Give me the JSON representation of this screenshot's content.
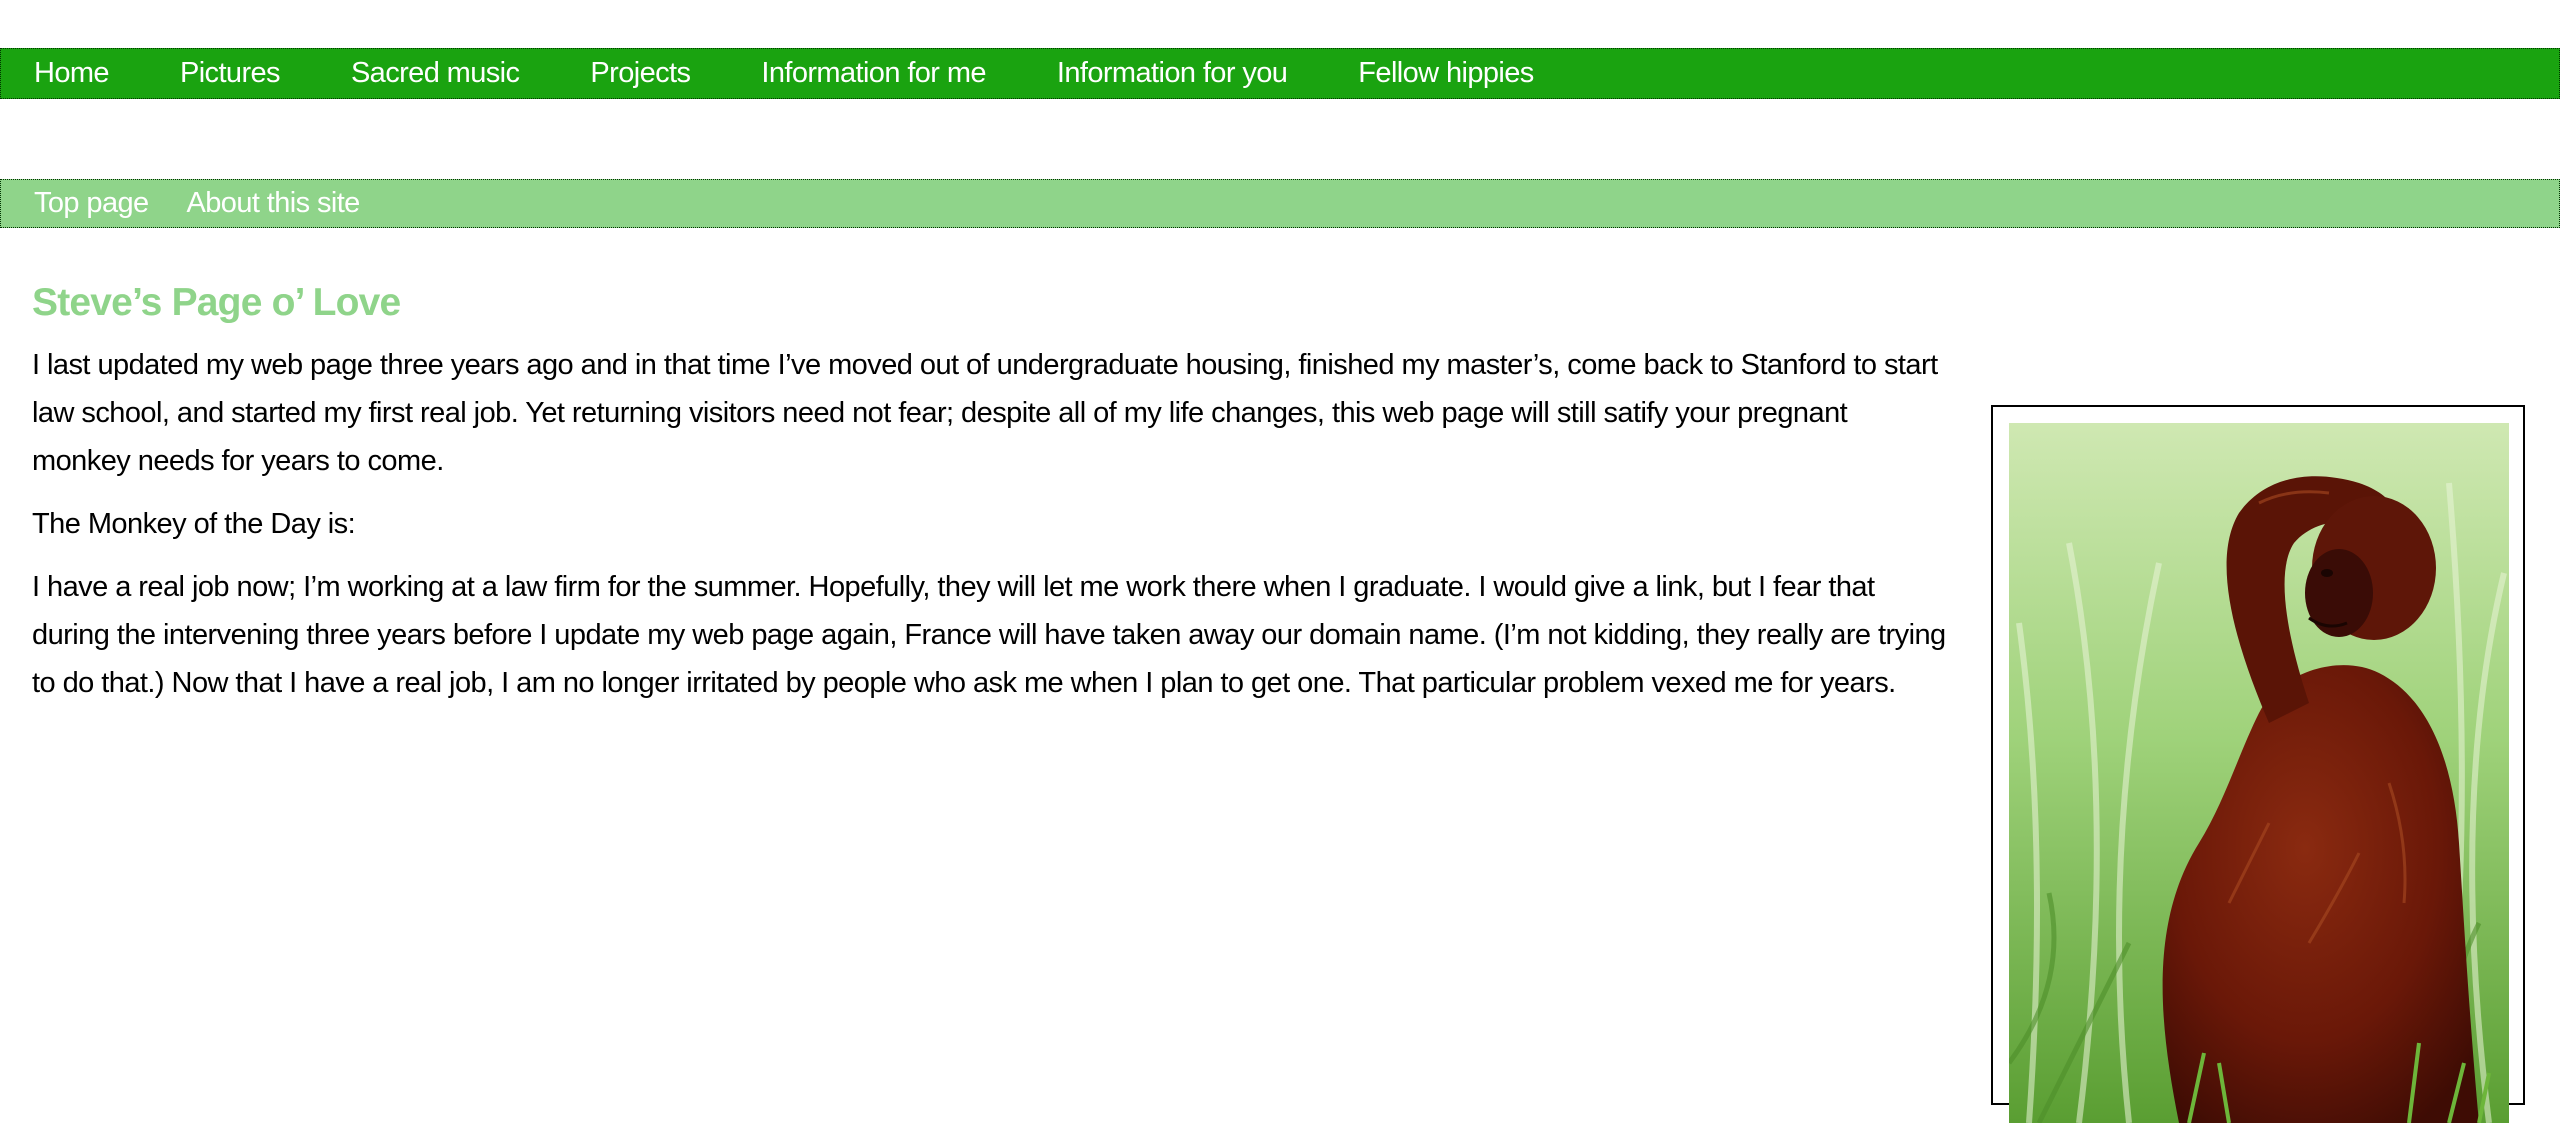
{
  "nav_primary": {
    "items": [
      {
        "label": "Home"
      },
      {
        "label": "Pictures"
      },
      {
        "label": "Sacred music"
      },
      {
        "label": "Projects"
      },
      {
        "label": "Information for me"
      },
      {
        "label": "Information for you"
      },
      {
        "label": "Fellow hippies"
      }
    ]
  },
  "nav_secondary": {
    "items": [
      {
        "label": "Top page"
      },
      {
        "label": "About this site"
      }
    ]
  },
  "main": {
    "title": "Steve’s Page o’ Love",
    "paragraphs": [
      "I last updated my web page three years ago and in that time I’ve moved out of undergraduate housing, finished my master’s, come back to Stanford to start law school, and started my first real job. Yet returning visitors need not fear; despite all of my life changes, this web page will still satify your pregnant monkey needs for years to come.",
      "The Monkey of the Day is:",
      "I have a real job now; I’m working at a law firm for the summer. Hopefully, they will let me work there when I graduate. I would give a link, but I fear that during the intervening three years before I update my web page again, France will have taken away our domain name. (I’m not kidding, they really are trying to do that.) Now that I have a real job, I am no longer irritated by people who ask me when I plan to get one. That particular problem vexed me for years."
    ]
  },
  "colors": {
    "nav_primary_bg": "#1aa310",
    "nav_secondary_bg": "#8fd48a",
    "title_color": "#8fd48a",
    "link_color": "#ffffff"
  }
}
